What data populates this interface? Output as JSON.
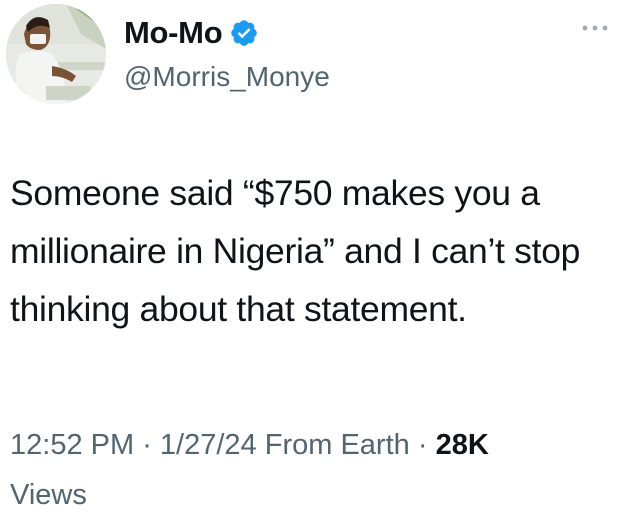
{
  "author": {
    "display_name": "Mo-Mo",
    "handle": "@Morris_Monye",
    "verified": true,
    "verified_color": "#1d9bf0"
  },
  "tweet": {
    "text": "Someone said “$750 makes you a millionaire in Nigeria” and I can’t stop thinking about that statement.",
    "time": "12:52 PM",
    "separator": " · ",
    "date": "1/27/24",
    "source": "From Earth",
    "views_count": "28K",
    "views_label": "Views"
  },
  "icons": {
    "avatar": "avatar-photo",
    "verified": "verified-badge-icon",
    "more": "more-options-icon"
  }
}
